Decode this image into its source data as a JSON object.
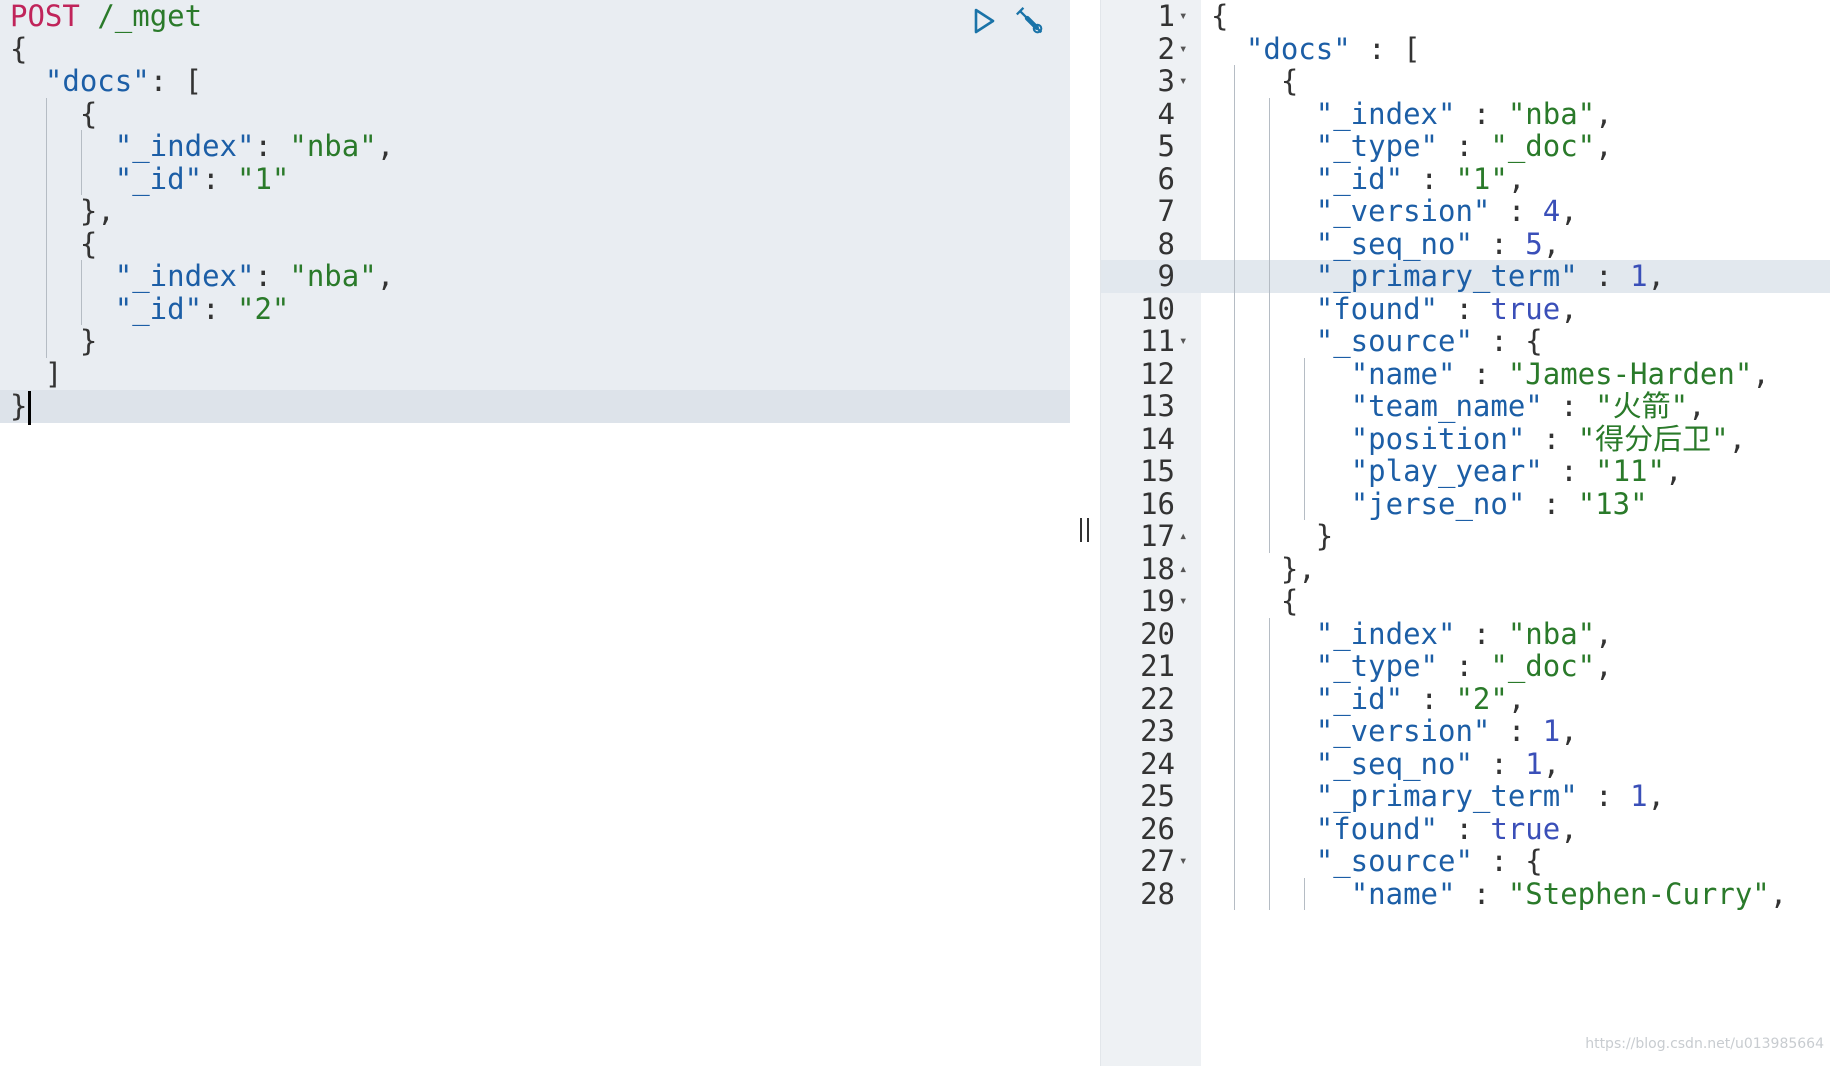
{
  "request": {
    "method": "POST",
    "endpoint": "/_mget",
    "lines": [
      {
        "indent": 0,
        "guides": 0,
        "tokens": [
          [
            "p",
            "{"
          ]
        ]
      },
      {
        "indent": 1,
        "guides": 0,
        "tokens": [
          [
            "k",
            "\"docs\""
          ],
          [
            "p",
            ": ["
          ]
        ]
      },
      {
        "indent": 2,
        "guides": 1,
        "tokens": [
          [
            "p",
            "{"
          ]
        ]
      },
      {
        "indent": 3,
        "guides": 2,
        "tokens": [
          [
            "k",
            "\"_index\""
          ],
          [
            "p",
            ": "
          ],
          [
            "s",
            "\"nba\""
          ],
          [
            "p",
            ","
          ]
        ]
      },
      {
        "indent": 3,
        "guides": 2,
        "tokens": [
          [
            "k",
            "\"_id\""
          ],
          [
            "p",
            ": "
          ],
          [
            "s",
            "\"1\""
          ]
        ]
      },
      {
        "indent": 2,
        "guides": 1,
        "tokens": [
          [
            "p",
            "},"
          ]
        ]
      },
      {
        "indent": 2,
        "guides": 1,
        "tokens": [
          [
            "p",
            "{"
          ]
        ]
      },
      {
        "indent": 3,
        "guides": 2,
        "tokens": [
          [
            "k",
            "\"_index\""
          ],
          [
            "p",
            ": "
          ],
          [
            "s",
            "\"nba\""
          ],
          [
            "p",
            ","
          ]
        ]
      },
      {
        "indent": 3,
        "guides": 2,
        "tokens": [
          [
            "k",
            "\"_id\""
          ],
          [
            "p",
            ": "
          ],
          [
            "s",
            "\"2\""
          ]
        ]
      },
      {
        "indent": 2,
        "guides": 1,
        "tokens": [
          [
            "p",
            "}"
          ]
        ]
      },
      {
        "indent": 1,
        "guides": 0,
        "tokens": [
          [
            "p",
            "]"
          ]
        ]
      },
      {
        "indent": 0,
        "guides": 0,
        "tokens": [
          [
            "p",
            "}"
          ]
        ],
        "cursor": true
      }
    ]
  },
  "icons": {
    "run": "play-icon",
    "settings": "wrench-icon",
    "resize": "drag-handle-icon"
  },
  "response": {
    "active_line": 9,
    "lines": [
      {
        "n": "1",
        "fold": "down",
        "indent": 0,
        "tokens": [
          [
            "p",
            "{"
          ]
        ]
      },
      {
        "n": "2",
        "fold": "down",
        "indent": 1,
        "tokens": [
          [
            "k",
            "\"docs\""
          ],
          [
            "p",
            " : ["
          ]
        ]
      },
      {
        "n": "3",
        "fold": "down",
        "indent": 2,
        "tokens": [
          [
            "p",
            "{"
          ]
        ]
      },
      {
        "n": "4",
        "indent": 3,
        "tokens": [
          [
            "k",
            "\"_index\""
          ],
          [
            "p",
            " : "
          ],
          [
            "s",
            "\"nba\""
          ],
          [
            "p",
            ","
          ]
        ]
      },
      {
        "n": "5",
        "indent": 3,
        "tokens": [
          [
            "k",
            "\"_type\""
          ],
          [
            "p",
            " : "
          ],
          [
            "s",
            "\"_doc\""
          ],
          [
            "p",
            ","
          ]
        ]
      },
      {
        "n": "6",
        "indent": 3,
        "tokens": [
          [
            "k",
            "\"_id\""
          ],
          [
            "p",
            " : "
          ],
          [
            "s",
            "\"1\""
          ],
          [
            "p",
            ","
          ]
        ]
      },
      {
        "n": "7",
        "indent": 3,
        "tokens": [
          [
            "k",
            "\"_version\""
          ],
          [
            "p",
            " : "
          ],
          [
            "b",
            "4"
          ],
          [
            "p",
            ","
          ]
        ]
      },
      {
        "n": "8",
        "indent": 3,
        "tokens": [
          [
            "k",
            "\"_seq_no\""
          ],
          [
            "p",
            " : "
          ],
          [
            "b",
            "5"
          ],
          [
            "p",
            ","
          ]
        ]
      },
      {
        "n": "9",
        "indent": 3,
        "tokens": [
          [
            "k",
            "\"_primary_term\""
          ],
          [
            "p",
            " : "
          ],
          [
            "b",
            "1"
          ],
          [
            "p",
            ","
          ]
        ]
      },
      {
        "n": "10",
        "indent": 3,
        "tokens": [
          [
            "k",
            "\"found\""
          ],
          [
            "p",
            " : "
          ],
          [
            "b",
            "true"
          ],
          [
            "p",
            ","
          ]
        ]
      },
      {
        "n": "11",
        "fold": "down",
        "indent": 3,
        "tokens": [
          [
            "k",
            "\"_source\""
          ],
          [
            "p",
            " : {"
          ]
        ]
      },
      {
        "n": "12",
        "indent": 4,
        "tokens": [
          [
            "k",
            "\"name\""
          ],
          [
            "p",
            " : "
          ],
          [
            "s",
            "\"James-Harden\""
          ],
          [
            "p",
            ","
          ]
        ]
      },
      {
        "n": "13",
        "indent": 4,
        "tokens": [
          [
            "k",
            "\"team_name\""
          ],
          [
            "p",
            " : "
          ],
          [
            "s",
            "\"火箭\""
          ],
          [
            "p",
            ","
          ]
        ]
      },
      {
        "n": "14",
        "indent": 4,
        "tokens": [
          [
            "k",
            "\"position\""
          ],
          [
            "p",
            " : "
          ],
          [
            "s",
            "\"得分后卫\""
          ],
          [
            "p",
            ","
          ]
        ]
      },
      {
        "n": "15",
        "indent": 4,
        "tokens": [
          [
            "k",
            "\"play_year\""
          ],
          [
            "p",
            " : "
          ],
          [
            "s",
            "\"11\""
          ],
          [
            "p",
            ","
          ]
        ]
      },
      {
        "n": "16",
        "indent": 4,
        "tokens": [
          [
            "k",
            "\"jerse_no\""
          ],
          [
            "p",
            " : "
          ],
          [
            "s",
            "\"13\""
          ]
        ]
      },
      {
        "n": "17",
        "fold": "up",
        "indent": 3,
        "tokens": [
          [
            "p",
            "}"
          ]
        ]
      },
      {
        "n": "18",
        "fold": "up",
        "indent": 2,
        "tokens": [
          [
            "p",
            "},"
          ]
        ]
      },
      {
        "n": "19",
        "fold": "down",
        "indent": 2,
        "tokens": [
          [
            "p",
            "{"
          ]
        ]
      },
      {
        "n": "20",
        "indent": 3,
        "tokens": [
          [
            "k",
            "\"_index\""
          ],
          [
            "p",
            " : "
          ],
          [
            "s",
            "\"nba\""
          ],
          [
            "p",
            ","
          ]
        ]
      },
      {
        "n": "21",
        "indent": 3,
        "tokens": [
          [
            "k",
            "\"_type\""
          ],
          [
            "p",
            " : "
          ],
          [
            "s",
            "\"_doc\""
          ],
          [
            "p",
            ","
          ]
        ]
      },
      {
        "n": "22",
        "indent": 3,
        "tokens": [
          [
            "k",
            "\"_id\""
          ],
          [
            "p",
            " : "
          ],
          [
            "s",
            "\"2\""
          ],
          [
            "p",
            ","
          ]
        ]
      },
      {
        "n": "23",
        "indent": 3,
        "tokens": [
          [
            "k",
            "\"_version\""
          ],
          [
            "p",
            " : "
          ],
          [
            "b",
            "1"
          ],
          [
            "p",
            ","
          ]
        ]
      },
      {
        "n": "24",
        "indent": 3,
        "tokens": [
          [
            "k",
            "\"_seq_no\""
          ],
          [
            "p",
            " : "
          ],
          [
            "b",
            "1"
          ],
          [
            "p",
            ","
          ]
        ]
      },
      {
        "n": "25",
        "indent": 3,
        "tokens": [
          [
            "k",
            "\"_primary_term\""
          ],
          [
            "p",
            " : "
          ],
          [
            "b",
            "1"
          ],
          [
            "p",
            ","
          ]
        ]
      },
      {
        "n": "26",
        "indent": 3,
        "tokens": [
          [
            "k",
            "\"found\""
          ],
          [
            "p",
            " : "
          ],
          [
            "b",
            "true"
          ],
          [
            "p",
            ","
          ]
        ]
      },
      {
        "n": "27",
        "fold": "down",
        "indent": 3,
        "tokens": [
          [
            "k",
            "\"_source\""
          ],
          [
            "p",
            " : {"
          ]
        ]
      },
      {
        "n": "28",
        "indent": 4,
        "tokens": [
          [
            "k",
            "\"name\""
          ],
          [
            "p",
            " : "
          ],
          [
            "s",
            "\"Stephen-Curry\""
          ],
          [
            "p",
            ","
          ]
        ]
      }
    ]
  },
  "watermark": "https://blog.csdn.net/u013985664"
}
